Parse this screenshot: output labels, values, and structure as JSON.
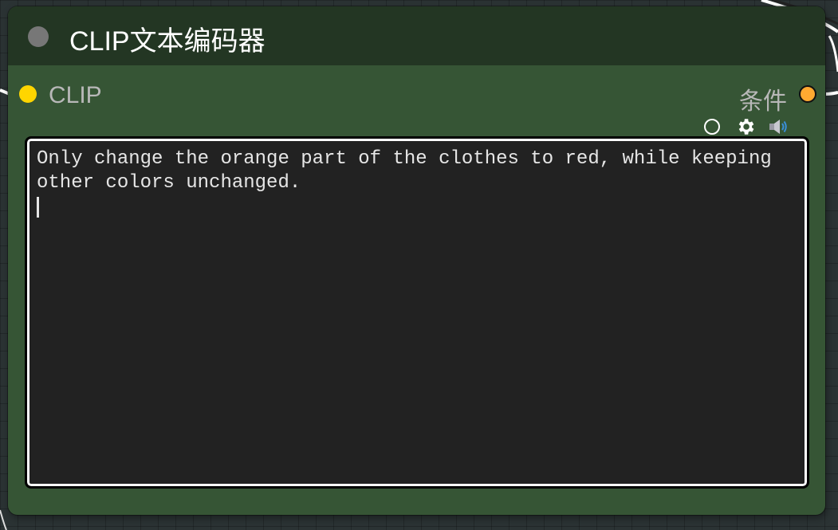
{
  "node": {
    "title": "CLIP文本编码器",
    "input_label": "CLIP",
    "output_label": "条件"
  },
  "widget": {
    "icons": [
      "circle-toggle-icon",
      "gear-icon",
      "speaker-icon"
    ],
    "text": "Only change the orange part of the clothes to red, while keeping other colors unchanged."
  },
  "colors": {
    "node_body": "#365535",
    "node_title": "#233623",
    "clip_slot": "#ffd500",
    "conditioning_slot": "#ffa931",
    "textarea_bg": "#222222"
  }
}
